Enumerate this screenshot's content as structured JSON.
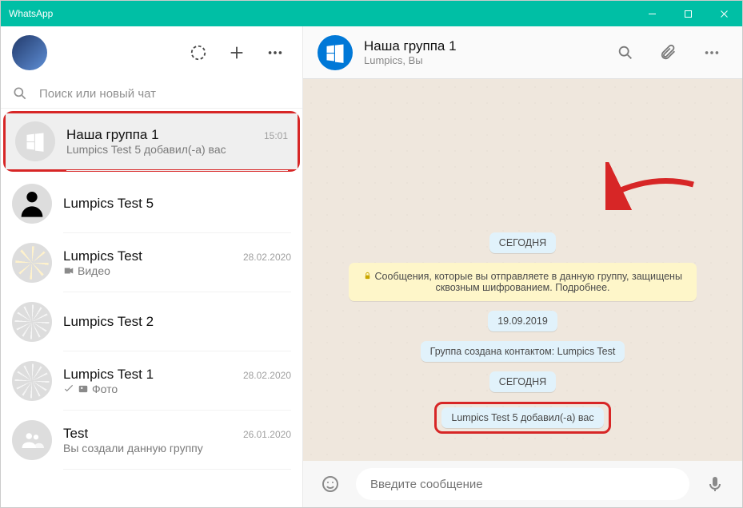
{
  "app": {
    "title": "WhatsApp"
  },
  "search": {
    "placeholder": "Поиск или новый чат"
  },
  "chats": [
    {
      "name": "Наша группа 1",
      "time": "15:01",
      "preview": "Lumpics Test 5 добавил(-а) вас",
      "avatar": "windows",
      "selected": true
    },
    {
      "name": "Lumpics Test 5",
      "time": "",
      "preview": "",
      "avatar": "bw-user"
    },
    {
      "name": "Lumpics Test",
      "time": "28.02.2020",
      "preview": "Видео",
      "preview_icon": "video",
      "avatar": "orange"
    },
    {
      "name": "Lumpics Test 2",
      "time": "",
      "preview": "",
      "avatar": "lime"
    },
    {
      "name": "Lumpics Test 1",
      "time": "28.02.2020",
      "preview": "Фото",
      "preview_icon": "photo",
      "tick": true,
      "avatar": "lemon"
    },
    {
      "name": "Test",
      "time": "26.01.2020",
      "preview": "Вы создали данную группу",
      "avatar": "grey-group"
    }
  ],
  "conversation": {
    "title": "Наша группа 1",
    "subtitle": "Lumpics, Вы",
    "avatar": "windows",
    "items": [
      {
        "kind": "date",
        "text": "СЕГОДНЯ"
      },
      {
        "kind": "banner",
        "text": "Сообщения, которые вы отправляете в данную группу, защищены сквозным шифрованием. Подробнее.",
        "lock": true
      },
      {
        "kind": "date",
        "text": "19.09.2019"
      },
      {
        "kind": "system",
        "text": "Группа создана контактом: Lumpics Test"
      },
      {
        "kind": "date",
        "text": "СЕГОДНЯ"
      },
      {
        "kind": "system",
        "text": "Lumpics Test 5 добавил(-а) вас",
        "highlight": true
      }
    ]
  },
  "composer": {
    "placeholder": "Введите сообщение"
  },
  "icons": {
    "status": "status-icon",
    "new_chat": "plus-icon",
    "menu": "dots-icon",
    "search": "search-icon",
    "attach": "paperclip-icon",
    "mic": "mic-icon",
    "emoji": "emoji-icon"
  }
}
